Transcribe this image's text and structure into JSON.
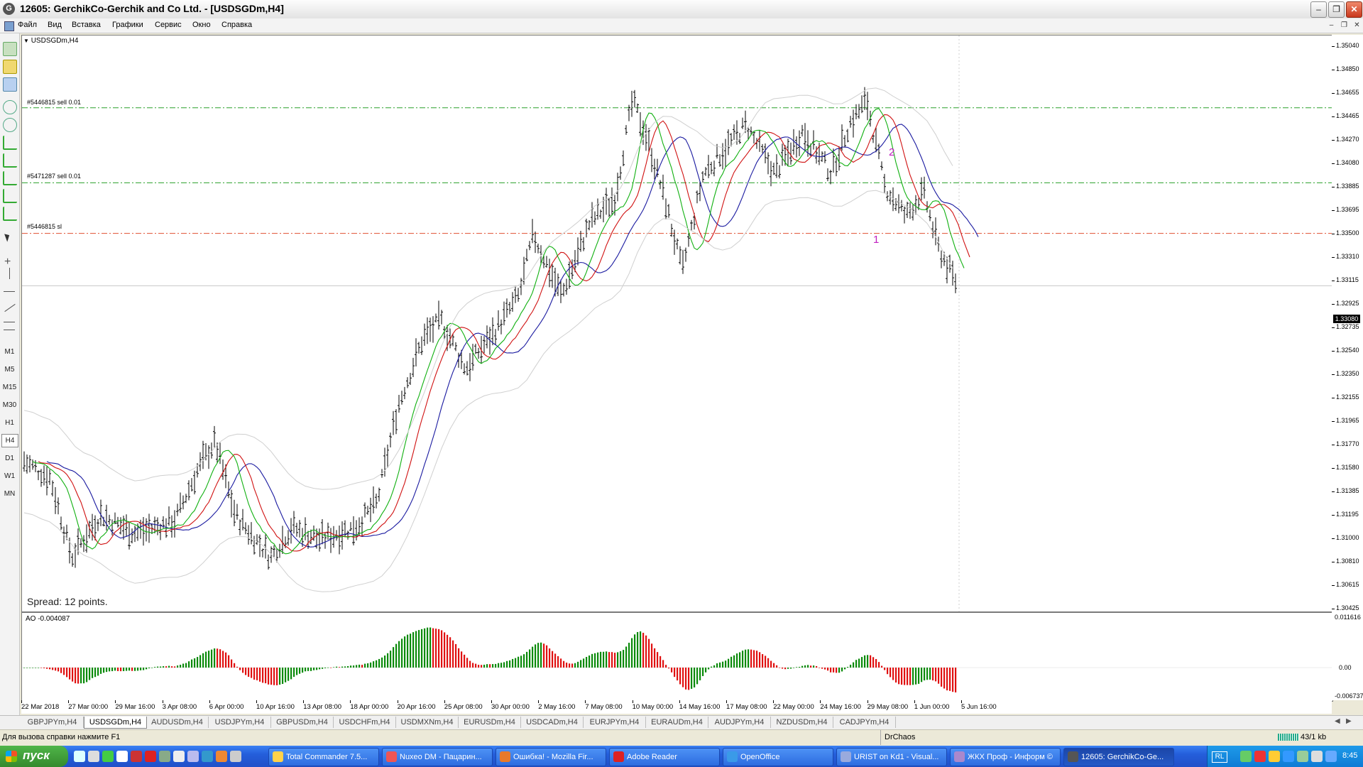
{
  "window": {
    "title": "12605: GerchikCo-Gerchik and Co Ltd. - [USDSGDm,H4]"
  },
  "menu": [
    "Файл",
    "Вид",
    "Вставка",
    "Графики",
    "Сервис",
    "Окно",
    "Справка"
  ],
  "timeframes": [
    "M1",
    "M5",
    "M15",
    "M30",
    "H1",
    "H4",
    "D1",
    "W1",
    "MN"
  ],
  "chart": {
    "symbol_label": "USDSGDm,H4",
    "spread_label": "Spread: 12 points.",
    "current_price": "1.33080",
    "order_lines": [
      {
        "label": "#5446815 sell 0.01",
        "price": 1.3454,
        "color": "#2aa02a",
        "style": "dashdot"
      },
      {
        "label": "#5471287 sell 0.01",
        "price": 1.33925,
        "color": "#2aa02a",
        "style": "dashdot"
      },
      {
        "label": "#5446815 sl",
        "price": 1.3351,
        "color": "#e05030",
        "style": "dashdot"
      }
    ],
    "annotations": [
      {
        "text": "1",
        "color": "#c020c0"
      },
      {
        "text": "2",
        "color": "#c020c0"
      }
    ],
    "price_ticks": [
      "1.35040",
      "1.34850",
      "1.34655",
      "1.34465",
      "1.34270",
      "1.34080",
      "1.33885",
      "1.33695",
      "1.33500",
      "1.33310",
      "1.33115",
      "1.32925",
      "1.32735",
      "1.32540",
      "1.32350",
      "1.32155",
      "1.31965",
      "1.31770",
      "1.31580",
      "1.31385",
      "1.31195",
      "1.31000",
      "1.30810",
      "1.30615",
      "1.30425"
    ],
    "date_ticks": [
      "22 Mar 2018",
      "27 Mar 00:00",
      "29 Mar 16:00",
      "3 Apr 08:00",
      "6 Apr 00:00",
      "10 Apr 16:00",
      "13 Apr 08:00",
      "18 Apr 00:00",
      "20 Apr 16:00",
      "25 Apr 08:00",
      "30 Apr 00:00",
      "2 May 16:00",
      "7 May 08:00",
      "10 May 00:00",
      "14 May 16:00",
      "17 May 08:00",
      "22 May 00:00",
      "24 May 16:00",
      "29 May 08:00",
      "1 Jun 00:00",
      "5 Jun 16:00"
    ]
  },
  "ao": {
    "label": "AO -0.004087",
    "ticks": [
      "0.011616",
      "0.00",
      "-0.006737"
    ]
  },
  "tabs": [
    "GBPJPYm,H4",
    "USDSGDm,H4",
    "AUDUSDm,H4",
    "USDJPYm,H4",
    "GBPUSDm,H4",
    "USDCHFm,H4",
    "USDMXNm,H4",
    "EURUSDm,H4",
    "USDCADm,H4",
    "EURJPYm,H4",
    "EURAUDm,H4",
    "AUDJPYm,H4",
    "NZDUSDm,H4",
    "CADJPYm,H4"
  ],
  "status": {
    "help": "Для вызова справки нажмите F1",
    "profile": "DrChaos",
    "traffic": "43/1 kb"
  },
  "taskbar": {
    "start": "пуск",
    "tasks": [
      "Total Commander 7.5...",
      "Nuxeo DM - Пацарин...",
      "Ошибка! - Mozilla Fir...",
      "Adobe Reader",
      "OpenOffice",
      "URIST on Kd1 - Visual...",
      "ЖКХ Проф - Информ ©",
      "12605: GerchikCo-Ge..."
    ],
    "lang": "RL",
    "clock": "8:45"
  }
}
